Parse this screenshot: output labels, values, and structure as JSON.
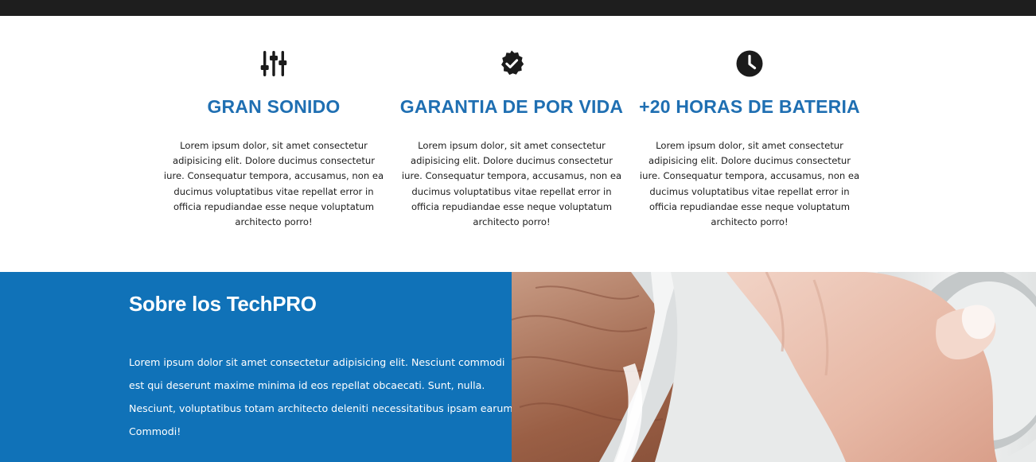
{
  "features": [
    {
      "icon": "sliders-icon",
      "title": "GRAN SONIDO",
      "text": "Lorem ipsum dolor, sit amet consectetur adipisicing elit. Dolore ducimus consectetur iure. Consequatur tempora, accusamus, non ea ducimus voluptatibus vitae repellat error in officia repudiandae esse neque voluptatum architecto porro!"
    },
    {
      "icon": "verified-badge-icon",
      "title": "GARANTIA DE POR VIDA",
      "text": "Lorem ipsum dolor, sit amet consectetur adipisicing elit. Dolore ducimus consectetur iure. Consequatur tempora, accusamus, non ea ducimus voluptatibus vitae repellat error in officia repudiandae esse neque voluptatum architecto porro!"
    },
    {
      "icon": "clock-icon",
      "title": "+20 HORAS DE BATERIA",
      "text": "Lorem ipsum dolor, sit amet consectetur adipisicing elit. Dolore ducimus consectetur iure. Consequatur tempora, accusamus, non ea ducimus voluptatibus vitae repellat error in officia repudiandae esse neque voluptatum architecto porro!"
    }
  ],
  "about": {
    "title": "Sobre los TechPRO",
    "text": "Lorem ipsum dolor sit amet consectetur adipisicing elit. Nesciunt commodi est qui deserunt maxime minima id eos repellat obcaecati. Sunt, nulla. Nesciunt, voluptatibus totam architecto deleniti necessitatibus ipsam earum! Commodi!"
  },
  "colors": {
    "accent": "#1f6fb2",
    "about_bg": "#1072b8",
    "topbar": "#1e1e1e",
    "icon": "#1b1b1b"
  }
}
